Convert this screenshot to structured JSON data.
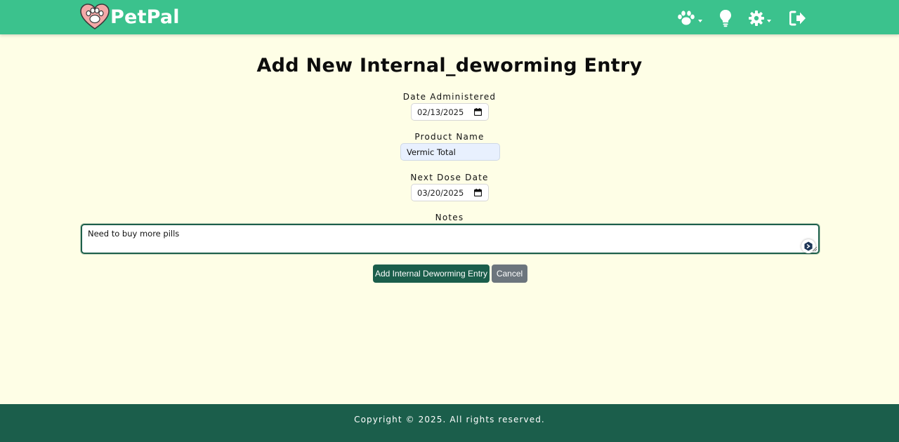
{
  "brand": {
    "name": "PetPal"
  },
  "nav": {
    "icons": [
      "paw-icon",
      "lightbulb-icon",
      "gear-icon",
      "logout-icon"
    ]
  },
  "page": {
    "title": "Add New Internal_deworming Entry"
  },
  "form": {
    "date_administered": {
      "label": "Date Administered",
      "value": "02/13/2025"
    },
    "product_name": {
      "label": "Product Name",
      "value": "Vermic Total"
    },
    "next_dose_date": {
      "label": "Next Dose Date",
      "value": "03/20/2025"
    },
    "notes": {
      "label": "Notes",
      "value": "Need to buy more pills"
    },
    "submit_label": "Add Internal Deworming Entry",
    "cancel_label": "Cancel"
  },
  "footer": {
    "text": "Copyright © 2025. All rights reserved."
  },
  "colors": {
    "navbar": "#3bc28d",
    "background": "#fefee6",
    "primary": "#1b5e4b",
    "secondary": "#6c757d"
  }
}
